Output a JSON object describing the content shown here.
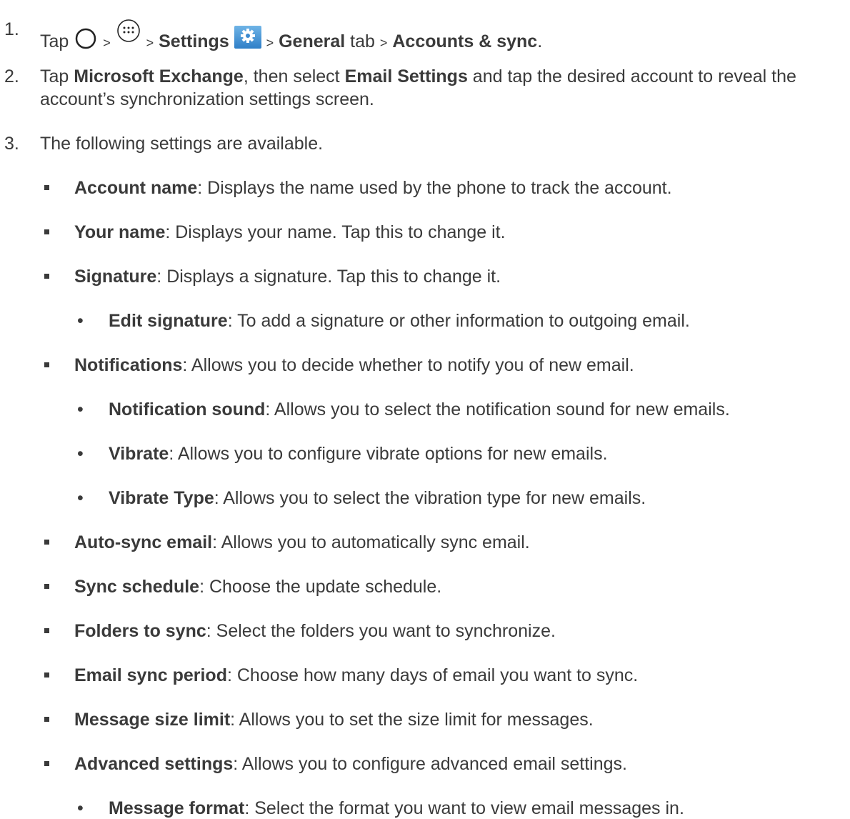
{
  "step1": {
    "num": "1.",
    "tap": "Tap",
    "gt": ">",
    "settings": "Settings",
    "general": "General",
    "tab": "tab",
    "accounts": "Accounts & sync",
    "end": ".",
    "icons": [
      "home-circle-icon",
      "apps-icon",
      "settings-gear-icon"
    ]
  },
  "step2": {
    "num": "2.",
    "p1": "Tap ",
    "b1": "Microsoft Exchange",
    "p2": ", then select ",
    "b2": "Email Settings",
    "p3": " and tap the desired account to reveal the",
    "line2": "account’s synchronization settings screen."
  },
  "step3": {
    "num": "3.",
    "text": "The following settings are available."
  },
  "items": [
    {
      "level": 1,
      "term": "Account name",
      "desc": ": Displays the name used by the phone to track the account."
    },
    {
      "level": 1,
      "term": "Your name",
      "desc": ": Displays your name. Tap this to change it."
    },
    {
      "level": 1,
      "term": "Signature",
      "desc": ": Displays a signature. Tap this to change it."
    },
    {
      "level": 2,
      "term": "Edit signature",
      "desc": ": To add a signature or other information to outgoing email."
    },
    {
      "level": 1,
      "term": "Notifications",
      "desc": ": Allows you to decide whether to notify you of new email."
    },
    {
      "level": 2,
      "term": "Notification sound",
      "desc": ": Allows you to select the notification sound for new emails."
    },
    {
      "level": 2,
      "term": "Vibrate",
      "desc": ": Allows you to configure vibrate options for new emails."
    },
    {
      "level": 2,
      "term": "Vibrate Type",
      "desc": ": Allows you to select the vibration type for new emails."
    },
    {
      "level": 1,
      "term": "Auto-sync email",
      "desc": ": Allows you to automatically sync email."
    },
    {
      "level": 1,
      "term": "Sync schedule",
      "desc": ": Choose the update schedule."
    },
    {
      "level": 1,
      "term": "Folders to sync",
      "desc": ": Select the folders you want to synchronize."
    },
    {
      "level": 1,
      "term": "Email sync period",
      "desc": ": Choose how many days of email you want to sync."
    },
    {
      "level": 1,
      "term": "Message size limit",
      "desc": ": Allows you to set the size limit for messages."
    },
    {
      "level": 1,
      "term": "Advanced settings",
      "desc": ": Allows you to configure advanced email settings."
    },
    {
      "level": 2,
      "term": "Message format",
      "desc": ": Select the format you want to view email messages in."
    }
  ],
  "bullet_dot": "•"
}
